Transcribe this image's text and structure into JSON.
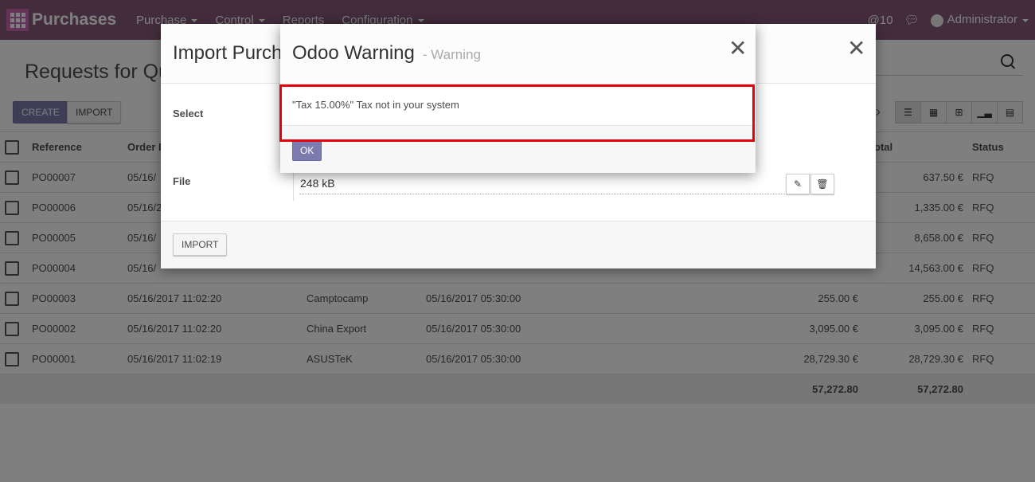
{
  "topbar": {
    "app_name": "Purchases",
    "menu": [
      "Purchase",
      "Control",
      "Reports",
      "Configuration"
    ],
    "notifications": "@10",
    "user": "Administrator"
  },
  "control_panel": {
    "title": "Requests for Qu",
    "create_label": "CREATE",
    "import_label": "IMPORT"
  },
  "table": {
    "headers": [
      "Reference",
      "Order D",
      "",
      "",
      "",
      "otal",
      "Status"
    ],
    "rows": [
      [
        "PO00007",
        "05/16/",
        "",
        "",
        "",
        "637.50 €",
        "RFQ"
      ],
      [
        "PO00006",
        "05/16/2",
        "",
        "",
        "",
        "1,335.00 €",
        "RFQ"
      ],
      [
        "PO00005",
        "05/16/",
        "",
        "",
        "",
        "8,658.00 €",
        "RFQ"
      ],
      [
        "PO00004",
        "05/16/",
        "",
        "",
        "",
        "14,563.00 €",
        "RFQ"
      ],
      [
        "PO00003",
        "05/16/2017 11:02:20",
        "Camptocamp",
        "05/16/2017 05:30:00",
        "255.00 €",
        "255.00 €",
        "RFQ"
      ],
      [
        "PO00002",
        "05/16/2017 11:02:20",
        "China Export",
        "05/16/2017 05:30:00",
        "3,095.00 €",
        "3,095.00 €",
        "RFQ"
      ],
      [
        "PO00001",
        "05/16/2017 11:02:19",
        "ASUSTeK",
        "05/16/2017 05:30:00",
        "28,729.30 €",
        "28,729.30 €",
        "RFQ"
      ]
    ],
    "totals": [
      "57,272.80",
      "57,272.80"
    ]
  },
  "import_dialog": {
    "title": "Import Purch",
    "select_label": "Select",
    "file_label": "File",
    "file_value": "248 kB",
    "import_button": "IMPORT"
  },
  "warning_dialog": {
    "title": "Odoo Warning",
    "subtitle": "- Warning",
    "message": "\"Tax 15.00%\" Tax not in your system",
    "ok_label": "OK"
  },
  "colors": {
    "topbar": "#875a7b",
    "primary": "#7c7bad",
    "highlight": "#e8000a"
  }
}
